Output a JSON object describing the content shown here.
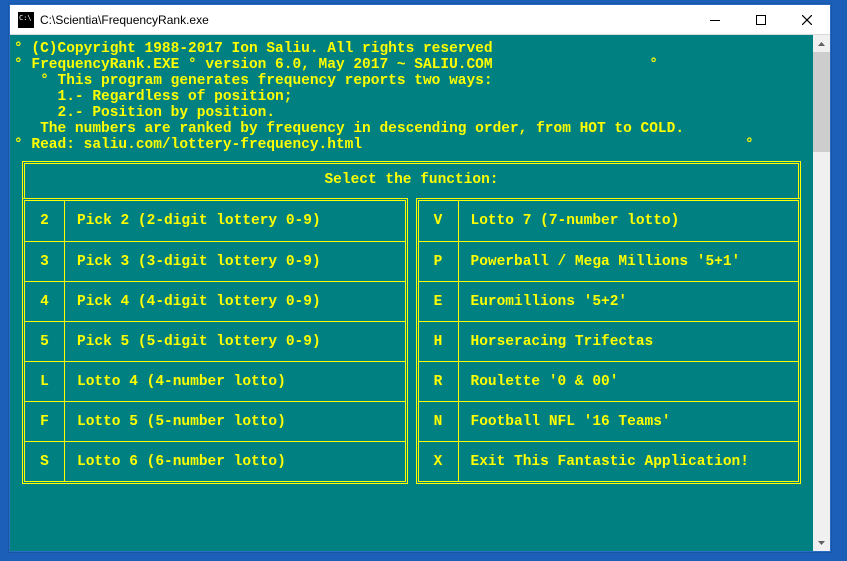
{
  "window": {
    "title": "C:\\Scientia\\FrequencyRank.exe"
  },
  "header": {
    "copyright": "(C)Copyright 1988-2017 Ion Saliu. All rights reserved",
    "program": "FrequencyRank.EXE ° version 6.0, May 2017 ~ SALIU.COM",
    "desc": "This program generates frequency reports two ways:",
    "opt1": "1.- Regardless of position;",
    "opt2": "2.- Position by position.",
    "rank": "The numbers are ranked by frequency in descending order, from HOT to COLD.",
    "read": "Read: saliu.com/lottery-frequency.html"
  },
  "menu": {
    "title": "Select the function:",
    "left": [
      {
        "key": "2",
        "label": "Pick 2 (2-digit lottery 0-9)"
      },
      {
        "key": "3",
        "label": "Pick 3 (3-digit lottery 0-9)"
      },
      {
        "key": "4",
        "label": "Pick 4 (4-digit lottery 0-9)"
      },
      {
        "key": "5",
        "label": "Pick 5 (5-digit lottery 0-9)"
      },
      {
        "key": "L",
        "label": "Lotto 4 (4-number lotto)"
      },
      {
        "key": "F",
        "label": "Lotto 5 (5-number lotto)"
      },
      {
        "key": "S",
        "label": "Lotto 6 (6-number lotto)"
      }
    ],
    "right": [
      {
        "key": "V",
        "label": "Lotto 7 (7-number lotto)"
      },
      {
        "key": "P",
        "label": "Powerball / Mega Millions '5+1'"
      },
      {
        "key": "E",
        "label": "Euromillions '5+2'"
      },
      {
        "key": "H",
        "label": "Horseracing Trifectas"
      },
      {
        "key": "R",
        "label": "Roulette '0 & 00'"
      },
      {
        "key": "N",
        "label": "Football NFL '16 Teams'"
      },
      {
        "key": "X",
        "label": "Exit This Fantastic Application!"
      }
    ]
  }
}
